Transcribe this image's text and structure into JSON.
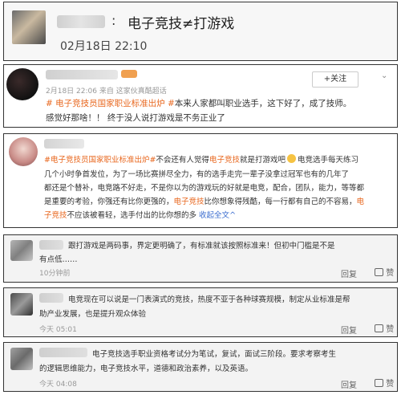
{
  "header": {
    "title": "电子竞技≠打游戏",
    "separator": ":",
    "time": "02月18日  22:10"
  },
  "post1": {
    "meta": "2月18日 22:06 来自 这家伙真酷超话",
    "follow_label": "+关注",
    "hashtag": "# 电子竞技员国家职业标准出炉 #",
    "line1_rest": "本来人家都叫职业选手，这下好了，成了技师。",
    "line2": "感觉好那啥！！ 终于没人说打游戏是不务正业了"
  },
  "post2": {
    "hashtag": "#电子竞技员国家职业标准出炉#",
    "l1a": "不会还有人觉得",
    "l1b": "电子竞技",
    "l1c": "就是打游戏吧",
    "l1d": "电竞选手每天练习",
    "l2": "几个小时争首发位，为了一场比赛拼尽全力，有的选手走完一辈子没拿过冠军也有的几年了",
    "l3": "都还是个替补，电竞路不好走，不是你以为的游戏玩的好就是电竞，配合，团队，能力，等等都",
    "l4": "是重要的考验，你强还有比你更强的，",
    "l4b": "电子竞技",
    "l4c": "比你想象得残酷，每一行都有自己的不容易，",
    "l4d": "电",
    "l5a": "子竞技",
    "l5b": "不应该被看轻，选手付出的比你想的多 ",
    "expand": "收起全文",
    "expand_arrow": "^"
  },
  "comments": [
    {
      "line1": "跟打游戏是两码事，界定更明确了，有标准就该按照标准来！但初中门槛是不是",
      "line2": "有点低……",
      "time": "10分钟前",
      "reply": "回复",
      "likes": "赞"
    },
    {
      "line1": "电竞现在可以说是一门表演式的竞技，热度不亚于各种球赛规模，制定从业标准是帮",
      "line2": "助产业发展，也是提升观众体验",
      "time": "今天 05:01",
      "reply": "回复",
      "likes": "赞"
    },
    {
      "line1": "电子竞技选手职业资格考试分为笔试，复试，面试三阶段。要求考察考生",
      "line2": "的逻辑思维能力，电子竞技水平，道德和政治素养，以及英语。",
      "time": "今天 04:08",
      "reply": "回复",
      "likes": "赞"
    }
  ],
  "colors": {
    "hashtag": "#e8671e",
    "link": "#3b6dcf",
    "follow": "#e8671e"
  }
}
